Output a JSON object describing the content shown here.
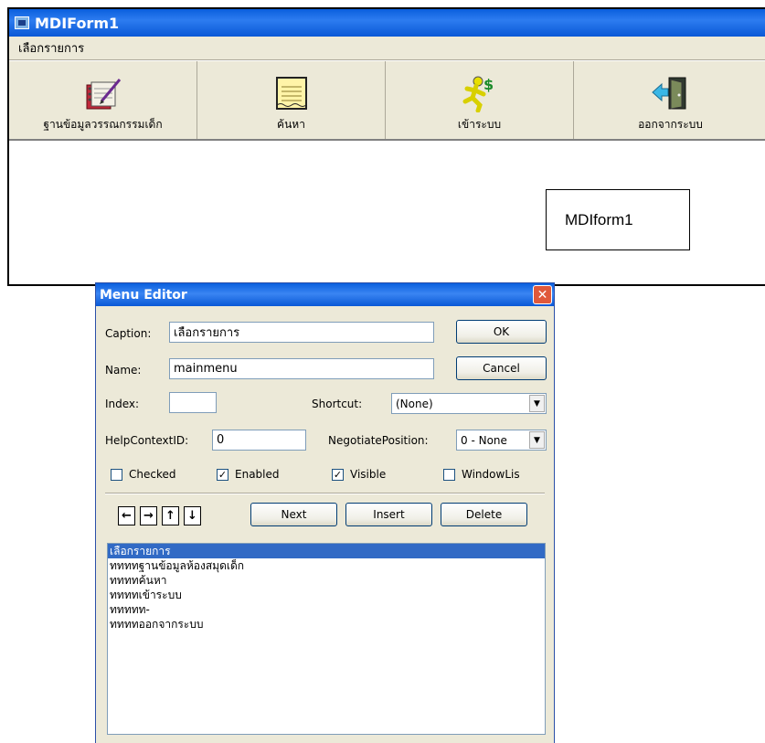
{
  "mdi": {
    "title": "MDIForm1",
    "menu": [
      "เลือกรายการ"
    ],
    "toolbar": [
      {
        "label": "ฐานข้อมูลวรรณกรรมเด็ก",
        "icon": "notebook-pen-icon"
      },
      {
        "label": "ค้นหา",
        "icon": "note-paper-icon"
      },
      {
        "label": "เข้าระบบ",
        "icon": "running-man-money-icon"
      },
      {
        "label": "ออกจากระบบ",
        "icon": "exit-door-icon"
      }
    ]
  },
  "callout": {
    "text": "MDIform1"
  },
  "menu_editor": {
    "title": "Menu Editor",
    "close_glyph": "✕",
    "caption_label": "Caption:",
    "caption_value": "เลือกรายการ",
    "name_label": "Name:",
    "name_value": "mainmenu",
    "index_label": "Index:",
    "index_value": "",
    "shortcut_label": "Shortcut:",
    "shortcut_value": "(None)",
    "helpcontext_label": "HelpContextID:",
    "helpcontext_value": "0",
    "negotiate_label": "NegotiatePosition:",
    "negotiate_value": "0 - None",
    "ok_label": "OK",
    "cancel_label": "Cancel",
    "checked_label": "Checked",
    "enabled_label": "Enabled",
    "visible_label": "Visible",
    "windowlist_label": "WindowLis",
    "checked": false,
    "enabled": true,
    "visible": true,
    "windowlist": false,
    "next_label": "Next",
    "insert_label": "Insert",
    "delete_label": "Delete",
    "arrows": [
      "←",
      "→",
      "↑",
      "↓"
    ],
    "list_items": [
      "เลือกรายการ",
      "ททททฐานข้อมูลห้องสมุดเด็ก",
      "ททททค้นหา",
      "ททททเข้าระบบ",
      "ททททท-",
      "ททททออกจากระบบ"
    ]
  }
}
